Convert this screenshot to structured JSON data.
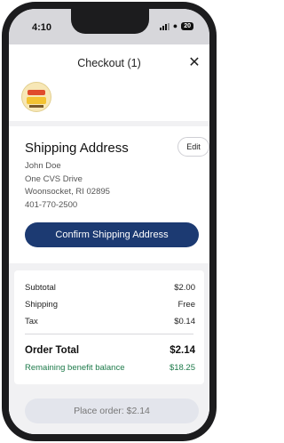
{
  "status_bar": {
    "time": "4:10",
    "battery": "20"
  },
  "header": {
    "title": "Checkout (1)",
    "close_icon": "close-icon"
  },
  "product": {
    "thumbnail_icon": "product-thumbnail"
  },
  "shipping": {
    "title": "Shipping Address",
    "edit_label": "Edit",
    "address_lines": [
      "John Doe",
      "One CVS Drive",
      "Woonsocket, RI 02895",
      "401-770-2500"
    ],
    "confirm_label": "Confirm Shipping Address"
  },
  "summary": {
    "subtotal_label": "Subtotal",
    "subtotal_value": "$2.00",
    "shipping_label": "Shipping",
    "shipping_value": "Free",
    "tax_label": "Tax",
    "tax_value": "$0.14",
    "total_label": "Order Total",
    "total_value": "$2.14",
    "benefit_label": "Remaining benefit balance",
    "benefit_value": "$18.25"
  },
  "place_order_label": "Place order: $2.14",
  "colors": {
    "primary": "#1c3a72",
    "benefit_green": "#1d7a4a",
    "disabled_button": "#e3e5ec"
  }
}
